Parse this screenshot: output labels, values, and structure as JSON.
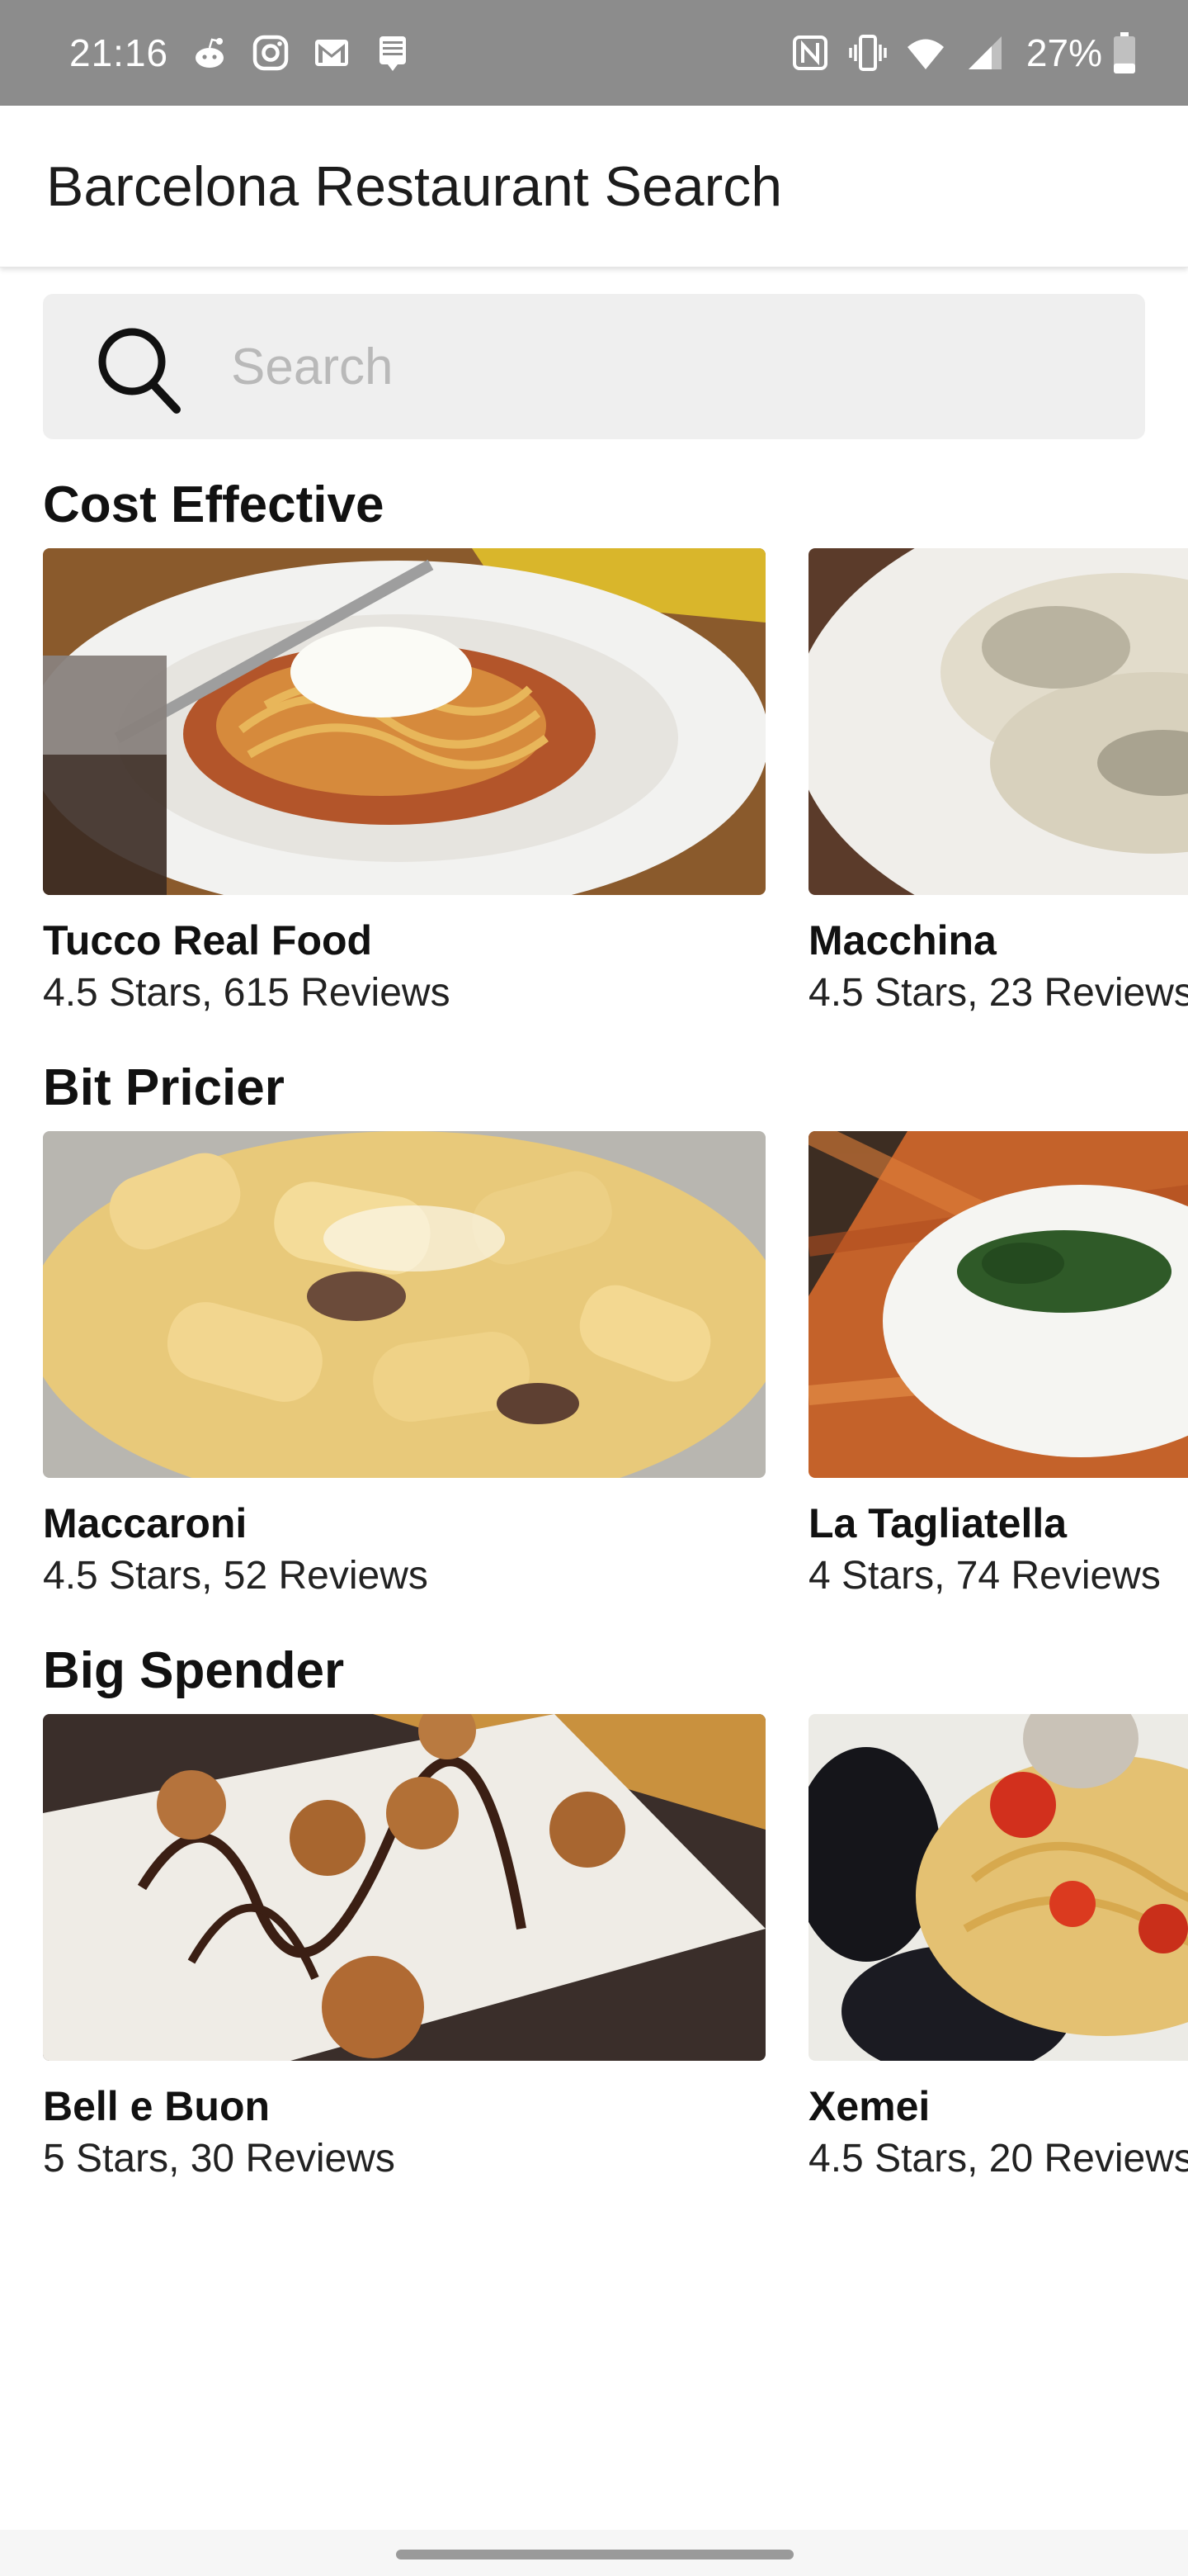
{
  "status_bar": {
    "time": "21:16",
    "battery_percent": "27%",
    "left_icons": [
      "reddit-icon",
      "instagram-icon",
      "gmail-icon",
      "notes-icon"
    ],
    "right_icons": [
      "nfc-icon",
      "vibrate-icon",
      "wifi-icon",
      "signal-icon"
    ],
    "battery_level": 0.27
  },
  "app_bar": {
    "title": "Barcelona Restaurant Search"
  },
  "search": {
    "placeholder": "Search",
    "value": ""
  },
  "sections": [
    {
      "title": "Cost Effective",
      "restaurants": [
        {
          "name": "Tucco Real Food",
          "meta": "4.5 Stars, 615 Reviews",
          "image": "spaghetti-image"
        },
        {
          "name": "Macchina",
          "meta": "4.5 Stars, 23 Reviews",
          "image": "ravioli-image"
        }
      ]
    },
    {
      "title": "Bit Pricier",
      "restaurants": [
        {
          "name": "Maccaroni",
          "meta": "4.5 Stars, 52 Reviews",
          "image": "rigatoni-image"
        },
        {
          "name": "La Tagliatella",
          "meta": "4 Stars, 74 Reviews",
          "image": "burrata-pasta-image"
        }
      ]
    },
    {
      "title": "Big Spender",
      "restaurants": [
        {
          "name": "Bell e Buon",
          "meta": "5 Stars, 30 Reviews",
          "image": "dessert-image"
        },
        {
          "name": "Xemei",
          "meta": "4.5 Stars, 20 Reviews",
          "image": "seafood-pasta-image"
        }
      ]
    }
  ],
  "colors": {
    "status_bar": "#8c8c8c",
    "search_bg": "#efefef",
    "placeholder": "#b9b9b9"
  }
}
